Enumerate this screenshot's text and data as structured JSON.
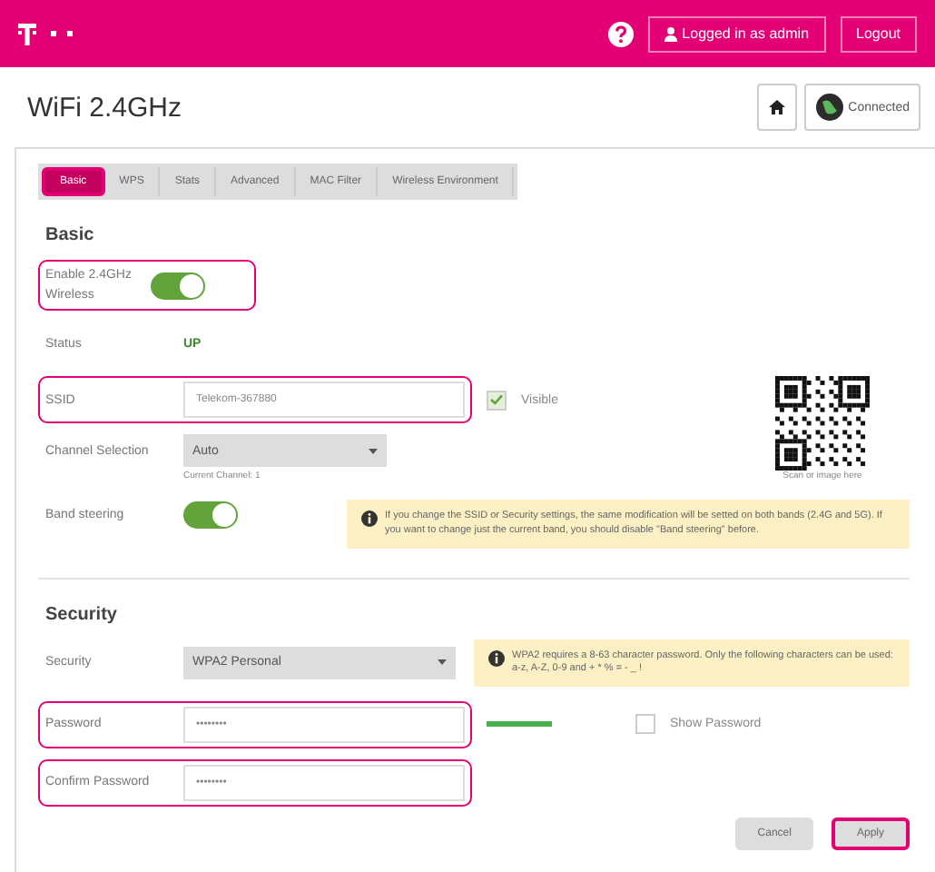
{
  "header": {
    "user_label": "Logged in as",
    "user_name": "admin",
    "logout": "Logout"
  },
  "page": {
    "title": "WiFi 2.4GHz",
    "connection": "Connected"
  },
  "tabs": [
    {
      "label": "Basic",
      "selected": true,
      "highlighted": true
    },
    {
      "label": "WPS",
      "selected": false,
      "highlighted": false
    },
    {
      "label": "Stats",
      "selected": false,
      "highlighted": false
    },
    {
      "label": "Advanced",
      "selected": false,
      "highlighted": false
    },
    {
      "label": "MAC Filter",
      "selected": false,
      "highlighted": false
    },
    {
      "label": "Wireless Environment",
      "selected": false,
      "highlighted": false
    }
  ],
  "basic": {
    "heading": "Basic",
    "enable": {
      "label": "Enable 2.4GHz Wireless",
      "on": true,
      "highlighted": true
    },
    "status": {
      "label": "Status",
      "value": "UP"
    },
    "ssid": {
      "label": "SSID",
      "value": "Telekom-367880",
      "highlighted": true,
      "visible_label": "Visible",
      "visible_checked": true
    },
    "qr_caption": "Scan or image here",
    "channel": {
      "label": "Channel Selection",
      "value": "Auto",
      "hint": "Current Channel: 1"
    },
    "band_steering": {
      "label": "Band steering",
      "on": true
    },
    "notice": "If you change the SSID or Security settings, the same modification will be setted on both bands (2.4G and 5G). If you want to change just the current band, you should disable \"Band steering\" before."
  },
  "security": {
    "heading": "Security",
    "mode": {
      "label": "Security",
      "value": "WPA2 Personal"
    },
    "notice": "WPA2 requires a 8-63 character password. Only the following characters can be used: a-z, A-Z, 0-9 and + * % = - _ !",
    "password": {
      "label": "Password",
      "value": "••••••••",
      "highlighted": true,
      "strength": {
        "level": 1
      }
    },
    "show_password": {
      "label": "Show Password",
      "checked": false
    },
    "confirm": {
      "label": "Confirm Password",
      "value": "••••••••",
      "highlighted": true
    }
  },
  "buttons": [
    {
      "label": "Cancel",
      "highlighted": false
    },
    {
      "label": "Apply",
      "highlighted": true
    }
  ]
}
